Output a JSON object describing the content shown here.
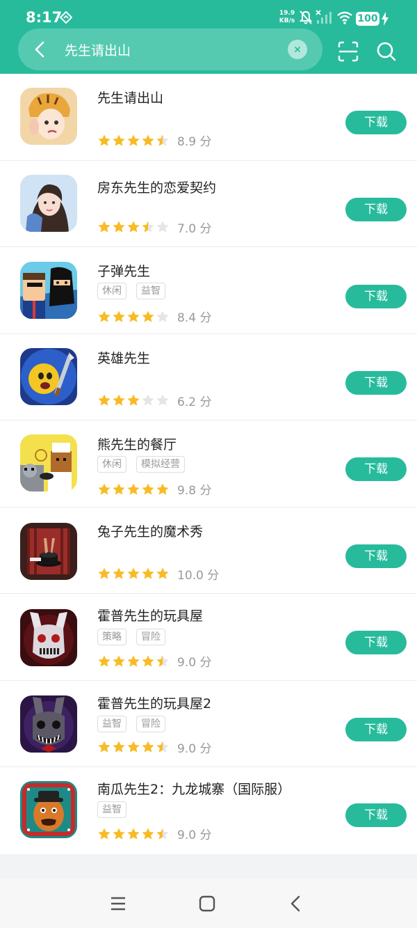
{
  "status": {
    "time": "8:17",
    "net_speed": "19.9",
    "net_unit": "KB/s",
    "battery": "100"
  },
  "search": {
    "query": "先生请出山",
    "back_icon": "back-arrow-icon",
    "clear_icon": "close-icon",
    "scan_icon": "scan-icon",
    "search_icon": "search-icon"
  },
  "colors": {
    "accent": "#27bb9c",
    "star": "#f8bb25",
    "star_empty": "#e5e5e5"
  },
  "download_label": "下载",
  "apps": [
    {
      "name": "先生请出山",
      "tags": [],
      "rating": 4.5,
      "score": "8.9 分"
    },
    {
      "name": "房东先生的恋爱契约",
      "tags": [],
      "rating": 3.5,
      "score": "7.0 分"
    },
    {
      "name": "子弹先生",
      "tags": [
        "休闲",
        "益智"
      ],
      "rating": 4,
      "score": "8.4 分"
    },
    {
      "name": "英雄先生",
      "tags": [],
      "rating": 3,
      "score": "6.2 分"
    },
    {
      "name": "熊先生的餐厅",
      "tags": [
        "休闲",
        "模拟经营"
      ],
      "rating": 5,
      "score": "9.8 分"
    },
    {
      "name": "兔子先生的魔术秀",
      "tags": [],
      "rating": 5,
      "score": "10.0 分"
    },
    {
      "name": "霍普先生的玩具屋",
      "tags": [
        "策略",
        "冒险"
      ],
      "rating": 4.5,
      "score": "9.0 分"
    },
    {
      "name": "霍普先生的玩具屋2",
      "tags": [
        "益智",
        "冒险"
      ],
      "rating": 4.5,
      "score": "9.0 分"
    },
    {
      "name": "南瓜先生2：九龙城寨（国际服）",
      "tags": [
        "益智"
      ],
      "rating": 4.5,
      "score": "9.0 分"
    }
  ],
  "nav": {
    "menu_icon": "menu-icon",
    "home_icon": "home-icon",
    "back_icon": "back-icon"
  }
}
